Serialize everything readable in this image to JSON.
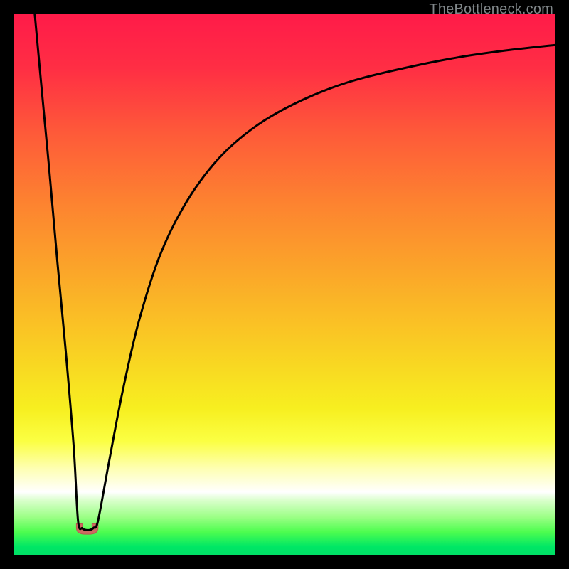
{
  "watermark": "TheBottleneck.com",
  "gradient": {
    "stops": [
      {
        "offset": 0.0,
        "color": "#ff1b49"
      },
      {
        "offset": 0.1,
        "color": "#ff2e44"
      },
      {
        "offset": 0.22,
        "color": "#fe5a39"
      },
      {
        "offset": 0.35,
        "color": "#fd8330"
      },
      {
        "offset": 0.48,
        "color": "#fba729"
      },
      {
        "offset": 0.62,
        "color": "#f9cf23"
      },
      {
        "offset": 0.73,
        "color": "#f7ef20"
      },
      {
        "offset": 0.79,
        "color": "#fbff43"
      },
      {
        "offset": 0.84,
        "color": "#feffb2"
      },
      {
        "offset": 0.884,
        "color": "#ffffff"
      },
      {
        "offset": 0.9,
        "color": "#d8ffca"
      },
      {
        "offset": 0.93,
        "color": "#9cff86"
      },
      {
        "offset": 0.958,
        "color": "#4dfd4f"
      },
      {
        "offset": 0.985,
        "color": "#00e765"
      },
      {
        "offset": 1.0,
        "color": "#00e066"
      }
    ]
  },
  "chart_data": {
    "type": "line",
    "title": "",
    "xlabel": "",
    "ylabel": "",
    "xlim": [
      0,
      100
    ],
    "ylim": [
      0,
      100
    ],
    "note": "x is normalized horizontal position (0=left edge of plot, 100=right). y is normalized height (0=bottom, 100=top). Two curve branches share a minimum near x≈13.",
    "series": [
      {
        "name": "left-branch",
        "x": [
          3.8,
          5.0,
          6.5,
          8.0,
          9.5,
          11.0,
          11.8
        ],
        "y": [
          100,
          87,
          71,
          54,
          38,
          20,
          6.3
        ]
      },
      {
        "name": "floor",
        "x": [
          11.8,
          12.6,
          13.2,
          14.0,
          14.7,
          15.5
        ],
        "y": [
          6.3,
          4.9,
          4.6,
          4.6,
          5.0,
          6.3
        ]
      },
      {
        "name": "right-branch",
        "x": [
          15.5,
          17.5,
          20.0,
          23.0,
          27.0,
          32.0,
          38.0,
          45.0,
          53.0,
          62.0,
          72.0,
          82.0,
          91.0,
          100.0
        ],
        "y": [
          6.3,
          17.0,
          30.0,
          43.0,
          55.5,
          65.5,
          73.5,
          79.5,
          84.0,
          87.5,
          90.0,
          92.0,
          93.3,
          94.3
        ]
      }
    ],
    "floor_marker": {
      "cx": 13.5,
      "cy": 5.0,
      "rx": 2.0,
      "ry": 1.2,
      "color": "#cc6a61"
    }
  }
}
